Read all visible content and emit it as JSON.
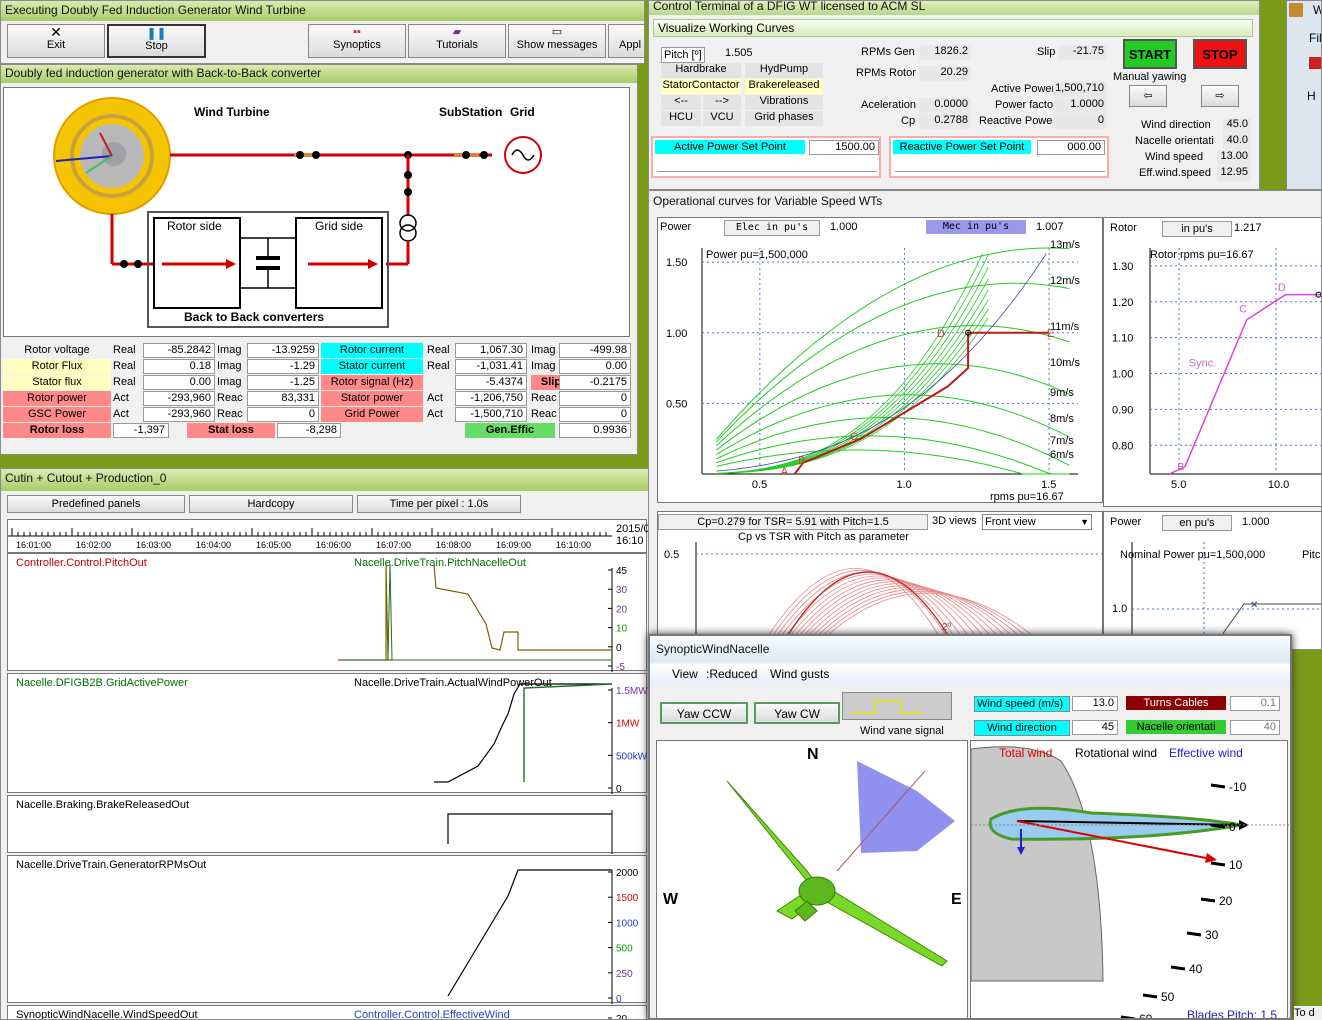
{
  "exec": {
    "title": "Executing Doubly Fed Induction Generator Wind Turbine",
    "buttons": [
      {
        "label": "Exit"
      },
      {
        "label": "Stop"
      },
      {
        "label": "Synoptics"
      },
      {
        "label": "Tutorials"
      },
      {
        "label": "Show messages"
      },
      {
        "label": "Appl"
      }
    ]
  },
  "dfig": {
    "title": "Doubly fed induction generator with Back-to-Back converter",
    "wind_turbine": "Wind Turbine",
    "substation": "SubStation",
    "grid": "Grid",
    "rotor_side": "Rotor side",
    "grid_side": "Grid side",
    "b2b": "Back to Back converters",
    "rows": [
      {
        "name": "Rotor voltage",
        "t1": "Real",
        "v1": "-85.2842",
        "t2": "Imag",
        "v2": "-13.9259",
        "name2": "Rotor current",
        "t3": "Real",
        "v3": "1,067.30",
        "t4": "Imag",
        "v4": "-499.98"
      },
      {
        "name": "Rotor Flux",
        "t1": "Real",
        "v1": "0.18",
        "t2": "Imag",
        "v2": "-1.29",
        "name2": "Stator current",
        "t3": "Real",
        "v3": "-1,031.41",
        "t4": "Imag",
        "v4": "0.00"
      },
      {
        "name": "Stator flux",
        "t1": "Real",
        "v1": "0.00",
        "t2": "Imag",
        "v2": "-1.25",
        "name2": "Rotor signal (Hz)",
        "t3": "",
        "v3": "-5.4374",
        "t4": "Slip",
        "v4": "-0.2175"
      },
      {
        "name": "Rotor power",
        "t1": "Act",
        "v1": "-293,960",
        "t2": "Reac",
        "v2": "83,331",
        "name2": "Stator power",
        "t3": "Act",
        "v3": "-1,206,750",
        "t4": "Reac",
        "v4": "0"
      },
      {
        "name": "GSC Power",
        "t1": "Act",
        "v1": "-293,960",
        "t2": "Reac",
        "v2": "0",
        "name2": "Grid Power",
        "t3": "Act",
        "v3": "-1,500,710",
        "t4": "Reac",
        "v4": "0"
      }
    ],
    "rotor_loss_label": "Rotor loss",
    "rotor_loss": "-1,397",
    "stat_loss_label": "Stat loss",
    "stat_loss": "-8,298",
    "gen_effic_label": "Gen.Effic",
    "gen_effic": "0.9936"
  },
  "cutin": {
    "title": "Cutin + Cutout + Production_0",
    "predefined": "Predefined panels",
    "hardcopy": "Hardcopy",
    "time_per_pixel": "Time per pixel : 1.0s",
    "date": "2015/0",
    "date2": "16:10",
    "times": [
      "16:01:00",
      "16:02:00",
      "16:03:00",
      "16:04:00",
      "16:05:00",
      "16:06:00",
      "16:07:00",
      "16:08:00",
      "16:09:00",
      "16:10:00"
    ],
    "panels": [
      {
        "left": "Controller.Control.PitchOut",
        "right": "Nacelle.DriveTrain.PitchNacelleOut",
        "ticks": [
          "45",
          "30",
          "20",
          "10",
          "0",
          "-5"
        ]
      },
      {
        "left": "Nacelle.DFIGB2B.GridActivePower",
        "right": "Nacelle.DriveTrain.ActualWindPowerOut",
        "ticks": [
          "1.5MW",
          "1MW",
          "500kW",
          "0"
        ]
      },
      {
        "left": "Nacelle.Braking.BrakeReleasedOut",
        "right": "",
        "ticks": []
      },
      {
        "left": "Nacelle.DriveTrain.GeneratorRPMsOut",
        "right": "",
        "ticks": [
          "2000",
          "1500",
          "1000",
          "500",
          "250",
          "0"
        ]
      },
      {
        "left": "SynopticWindNacelle.WindSpeedOut",
        "right": "Controller.Control.EffectiveWind",
        "ticks": [
          "20"
        ]
      }
    ]
  },
  "ct": {
    "title": "Control Terminal of a DFIG WT licensed to ACM SL",
    "visualize": "Visualize Working Curves",
    "pitch_label": "Pitch [º]",
    "pitch": "1.505",
    "toggles": [
      "Hardbrake",
      "HydPump",
      "StatorContactor",
      "Brakereleased",
      "<--",
      "-->",
      "Vibrations",
      "HCU",
      "VCU",
      "Grid phases"
    ],
    "rpm_gen_label": "RPMs Gen",
    "rpm_gen": "1826.2",
    "slip_label": "Slip",
    "slip": "-21.75",
    "rpm_rotor_label": "RPMs Rotor",
    "rpm_rotor": "20.29",
    "active_power_label": "Active Power",
    "active_power": "1,500,710",
    "accel_label": "Aceleration",
    "accel": "0.0000",
    "pf_label": "Power factor",
    "pf": "1.0000",
    "cp_label": "Cp",
    "cp": "0.2788",
    "reactive_label": "Reactive Power",
    "reactive": "0",
    "start": "START",
    "stop": "STOP",
    "manual_yaw": "Manual yawing",
    "wind_dir_label": "Wind direction",
    "wind_dir": "45.0",
    "nacelle_label": "Nacelle orientati",
    "nacelle": "40.0",
    "wind_speed_label": "Wind speed",
    "wind_speed": "13.00",
    "eff_wind_label": "Eff.wind.speed",
    "eff_wind": "12.95",
    "aps_label": "Active Power Set Point",
    "aps": "1500.00",
    "rps_label": "Reactive Power Set Point",
    "rps": "000.00"
  },
  "oc": {
    "title": "Operational curves for Variable Speed WTs",
    "power_label": "Power",
    "elec_label": "Elec in pu's",
    "elec": "1.000",
    "mec_label": "Mec in pu's",
    "mec": "1.007",
    "power_pu": "Power pu=1,500,000",
    "rpms_pu": "rpms pu=16.67",
    "wind_labels": [
      "13m/s",
      "12m/s",
      "11m/s",
      "10m/s",
      "9m/s",
      "8m/s",
      "7m/s",
      "6m/s"
    ],
    "pts": [
      "A",
      "B",
      "C",
      "D",
      "E"
    ],
    "rotor_label": "Rotor",
    "rotor_pu_label": "in pu's",
    "rotor_pu": "1.217",
    "rotor_rpms_pu": "Rotor rpms pu=16.67",
    "sync": "Sync.",
    "cp_title": "Cp=0.279 for TSR= 5.91  with Pitch=1.5",
    "cp_sub": "Cp vs TSR with Pitch as parameter",
    "views_label": "3D views",
    "view": "Front view",
    "power2_label": "Power",
    "power2_pu_label": "en pu's",
    "power2": "1.000",
    "nominal": "Nominal Power pu=1,500,000",
    "pitc": "Pitc"
  },
  "chart_data": [
    {
      "type": "line",
      "title": "Power pu=1,500,000",
      "xlabel": "rpms pu=16.67",
      "xlim": [
        0.3,
        1.6
      ],
      "ylim": [
        0,
        1.6
      ],
      "x_ticks": [
        0.5,
        1.0,
        1.5
      ],
      "y_ticks": [
        0.5,
        1.0,
        1.5
      ],
      "series": [
        {
          "name": "13m/s"
        },
        {
          "name": "12m/s"
        },
        {
          "name": "11m/s"
        },
        {
          "name": "10m/s"
        },
        {
          "name": "9m/s"
        },
        {
          "name": "8m/s"
        },
        {
          "name": "7m/s"
        },
        {
          "name": "6m/s"
        }
      ],
      "operating_curve": {
        "x": [
          0.62,
          0.65,
          0.85,
          1.15,
          1.22,
          1.22,
          1.5
        ],
        "y": [
          0.0,
          0.08,
          0.25,
          0.62,
          0.75,
          1.0,
          1.0
        ]
      }
    },
    {
      "type": "line",
      "title": "Rotor rpms pu=16.67",
      "xlim": [
        3.5,
        13
      ],
      "ylim": [
        0.72,
        1.35
      ],
      "x_ticks": [
        5.0,
        10.0
      ],
      "y_ticks": [
        0.8,
        0.9,
        1.0,
        1.1,
        1.2,
        1.3
      ],
      "x": [
        4.5,
        5.3,
        8.5,
        10.5,
        13
      ],
      "y": [
        0.72,
        0.74,
        1.15,
        1.22,
        1.22
      ]
    },
    {
      "type": "line",
      "title": "Cp vs TSR with Pitch as parameter",
      "y_ticks": [
        0.5
      ]
    }
  ],
  "syn": {
    "title": "SynopticWindNacelle",
    "menu": [
      "View",
      ":Reduced",
      "Wind gusts"
    ],
    "yaw_ccw": "Yaw CCW",
    "yaw_cw": "Yaw CW",
    "vane": "Wind vane signal",
    "ws_label": "Wind speed (m/s)",
    "ws": "13.0",
    "wd_label": "Wind direction",
    "wd": "45",
    "turns_label": "Turns Cables",
    "turns": "0.1",
    "nac_label": "Nacelle orientati",
    "nac": "40",
    "N": "N",
    "W": "W",
    "E": "E",
    "total_wind": "Total wind",
    "rot_wind": "Rotational wind",
    "eff_wind": "Effective wind",
    "angles": [
      "-10",
      "0",
      "10",
      "20",
      "30",
      "40",
      "50",
      "60"
    ],
    "blades_pitch": "Blades Pitch: 1.5"
  },
  "right": {
    "w": "W",
    "fil": "Fil",
    "h": "H",
    "to": "To d"
  }
}
